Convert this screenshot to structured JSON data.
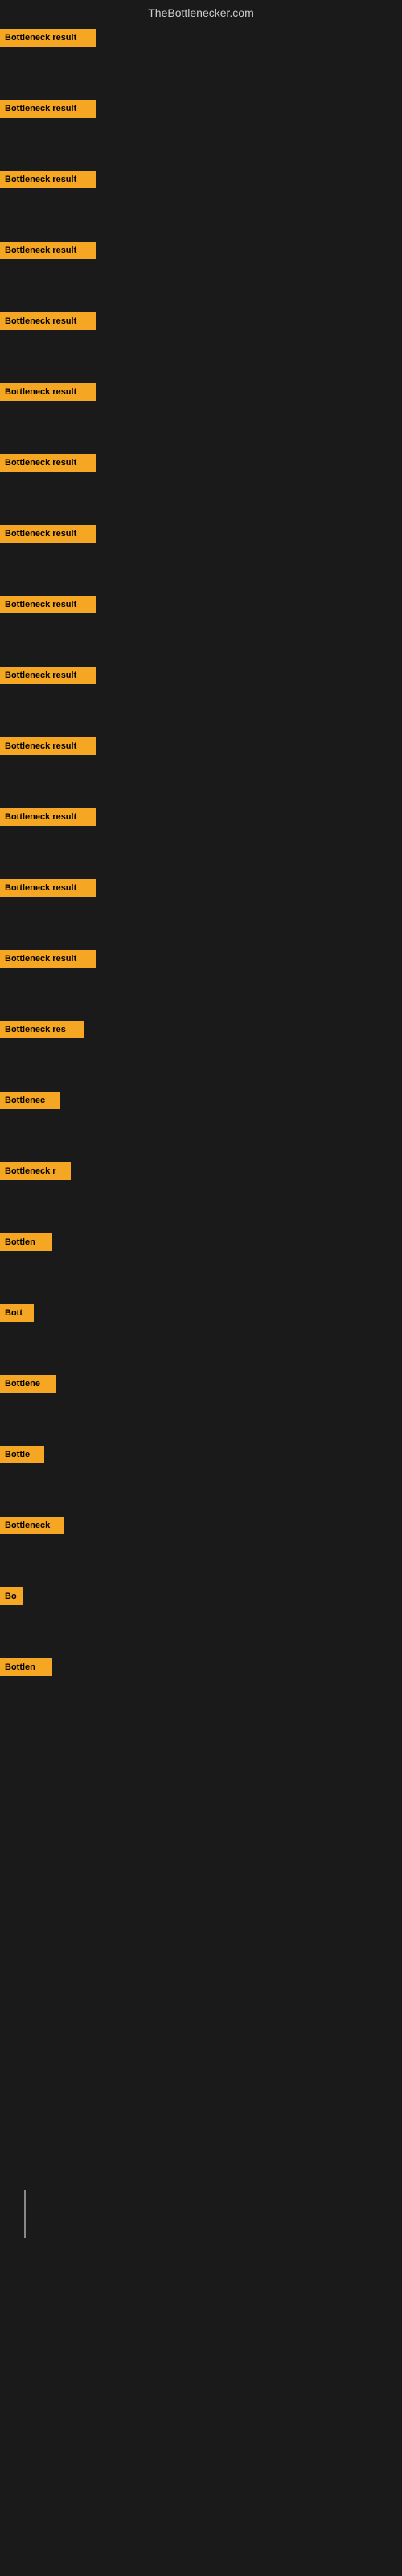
{
  "site": {
    "title": "TheBottlenecker.com"
  },
  "bars": [
    {
      "label": "Bottleneck result",
      "width": 120
    },
    {
      "label": "Bottleneck result",
      "width": 120
    },
    {
      "label": "Bottleneck result",
      "width": 120
    },
    {
      "label": "Bottleneck result",
      "width": 120
    },
    {
      "label": "Bottleneck result",
      "width": 120
    },
    {
      "label": "Bottleneck result",
      "width": 120
    },
    {
      "label": "Bottleneck result",
      "width": 120
    },
    {
      "label": "Bottleneck result",
      "width": 120
    },
    {
      "label": "Bottleneck result",
      "width": 120
    },
    {
      "label": "Bottleneck result",
      "width": 120
    },
    {
      "label": "Bottleneck result",
      "width": 120
    },
    {
      "label": "Bottleneck result",
      "width": 120
    },
    {
      "label": "Bottleneck result",
      "width": 120
    },
    {
      "label": "Bottleneck result",
      "width": 120
    },
    {
      "label": "Bottleneck res",
      "width": 105
    },
    {
      "label": "Bottlenec",
      "width": 75
    },
    {
      "label": "Bottleneck r",
      "width": 88
    },
    {
      "label": "Bottlen",
      "width": 65
    },
    {
      "label": "Bott",
      "width": 42
    },
    {
      "label": "Bottlene",
      "width": 70
    },
    {
      "label": "Bottle",
      "width": 55
    },
    {
      "label": "Bottleneck",
      "width": 80
    },
    {
      "label": "Bo",
      "width": 28
    },
    {
      "label": "Bottlen",
      "width": 65
    }
  ]
}
